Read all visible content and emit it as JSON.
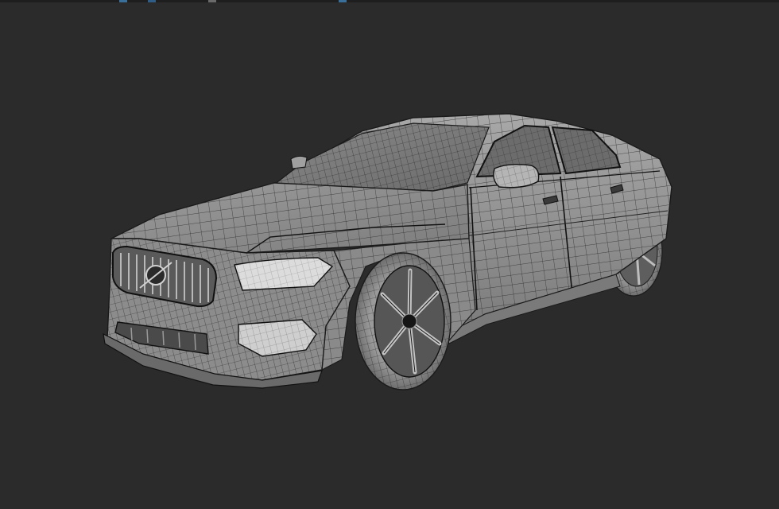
{
  "viewport": {
    "background_color": "#2b2b2b",
    "shading_mode": "shaded-wireframe"
  },
  "model": {
    "subject": "car-3d-model",
    "body_color": "#8e8e8e",
    "highlight_color": "#d4d4d4",
    "wire_color": "#1a1a1a"
  },
  "top_strip_accents": [
    "#3a6f9a",
    "#2f5d85",
    "#6a6a6a",
    "#3a6f9a"
  ]
}
